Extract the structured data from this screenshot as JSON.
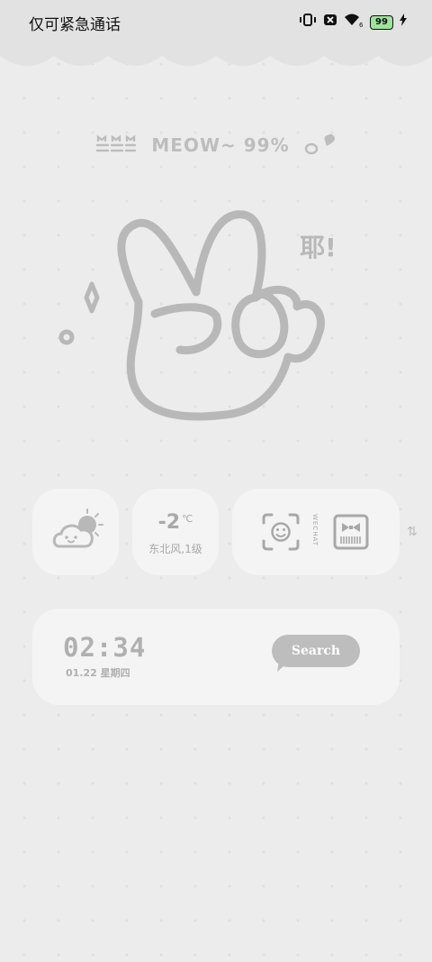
{
  "status_bar": {
    "carrier_text": "仅可紧急通话",
    "battery_level": "99",
    "wifi_sub": "6"
  },
  "header": {
    "meow_text": "MEOW~ 99%"
  },
  "hero": {
    "exclaim_text": "耶!"
  },
  "widgets": {
    "temperature": "-2",
    "temperature_unit": "℃",
    "wind": "东北风,1级",
    "wechat_label": "WECHAT"
  },
  "clock": {
    "time": "02:34",
    "date": "01.22 星期四",
    "search_label": "Search"
  },
  "icons": {
    "status": [
      "vibrate-icon",
      "notification-icon",
      "wifi-icon",
      "battery-icon",
      "charging-icon"
    ],
    "widgets": [
      "weather-cloud-sun-icon",
      "face-scan-icon",
      "barcode-icon"
    ]
  },
  "colors": {
    "background": "#ececec",
    "card": "#f4f4f4",
    "muted": "#b0b0b0",
    "battery_fill": "#9fe39a"
  }
}
